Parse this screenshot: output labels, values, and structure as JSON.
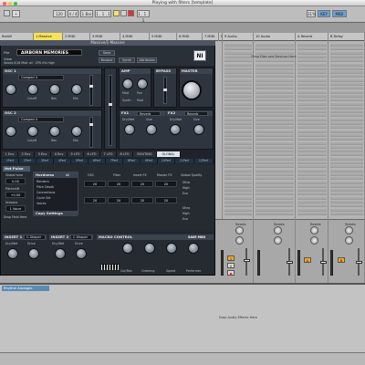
{
  "window": {
    "title": "Playing with filters [template]"
  },
  "transport": {
    "tempo": "120",
    "signature": "4 / 4",
    "bars": "1 Bar",
    "position": "1 . 1 . 1",
    "loop_start": "1 . 1 . 1",
    "cpu": "31%",
    "key_badge": "KEY",
    "midi_badge": "MIDI"
  },
  "tracks": [
    {
      "label": "Rodrill"
    },
    {
      "label": "1 Massive"
    },
    {
      "label": "2 MIDI"
    },
    {
      "label": "3 MIDI"
    },
    {
      "label": "4 MIDI"
    },
    {
      "label": "5 MIDI"
    },
    {
      "label": "6 MIDI"
    },
    {
      "label": "7 MIDI"
    },
    {
      "label": "8 MIDI"
    },
    {
      "label": "9 Audio"
    },
    {
      "label": "10 Audio"
    },
    {
      "label": "A Reverb"
    },
    {
      "label": "B Delay"
    }
  ],
  "session": {
    "drop_hint": "Drop Files and Devices Here"
  },
  "plugin": {
    "window_title": "Massive/1-Massive",
    "file_label": "File",
    "view_label": "View",
    "preset_name": "AIRBORN MEMORIES",
    "info_line": "Voices  0/16   Midi: all  ·  CPU  0%  High",
    "save_label": "Save",
    "browse_label": "Browse",
    "synth_label": "Synth",
    "attributes_label": "Attributes",
    "logo": "NI",
    "osc1_title": "OSC 1",
    "osc1_wave": "Comped 4",
    "osc2_title": "OSC 2",
    "osc2_wave": "Comped 4",
    "osc3_title": "OSC 3",
    "filter1_title": "FILTER 1",
    "filter1_type": "Lowpass 4",
    "filter2_title": "FILTER 2",
    "filter2_type": "Lowpass 4",
    "amp_title": "AMP",
    "bypass_title": "BYPASS",
    "master_title": "MASTER",
    "fx1_title": "FX1",
    "fx1_type": "Reverb",
    "fx2_title": "FX2",
    "fx2_type": "Reverb",
    "knob_labels": [
      "Cutoff",
      "Res",
      "Mix",
      "Cutoff",
      "Res",
      "Mix",
      "Dry/Wet",
      "Size",
      "Dry/Wet",
      "Size"
    ],
    "amp_labels": [
      "Mod",
      "Pan",
      "Synth",
      "Mod"
    ],
    "tabs": [
      "1 Env",
      "2 Env",
      "3 Env",
      "4 Env",
      "5 LFO",
      "6 LFO",
      "7 LFO",
      "8 LFO",
      "ROUTING",
      "GLOBAL"
    ],
    "tab_active": "GLOBAL",
    "mod_strip": [
      "1Perf",
      "2Perf",
      "3Perf",
      "4Perf",
      "5Perf",
      "6Perf",
      "7Perf",
      "8Perf",
      "9Perf",
      "10Perf",
      "11Perf",
      "12Perf"
    ],
    "global_header": "Hot Pulse",
    "global_tune_label": "Global tune",
    "global_tune_value": "0.00",
    "pitchshift_label": "Pitchshift",
    "pitchshift_value": "+0.00",
    "unison_label": "Unisono",
    "unison_value": "1 Voice",
    "hardness_label": "Hardness",
    "hardness_value": "All",
    "column_labels": [
      "OSC",
      "Filter",
      "Insert FX",
      "Master FX",
      "Global Quality"
    ],
    "values_row1": [
      "20",
      "20",
      "20",
      "20"
    ],
    "values_row2": [
      "20",
      "20",
      "20",
      "20"
    ],
    "quality_options": [
      "Ultra",
      "High",
      "Eco"
    ],
    "mod_rows": [
      "Random",
      "Pitch Depth",
      "Connections",
      "Cycle Set",
      "Voices"
    ],
    "drag_hint": "Drop Field Here",
    "copy_settings": "Copy Settings",
    "insert1_title": "INSERT 1",
    "insert1_type": "C-Shaper",
    "insert2_title": "INSERT 2",
    "insert2_type": "C-Shaper",
    "macro_title": "MACRO CONTROL",
    "save_midi": "SAVE MIDI",
    "macro_labels": [
      "Cut/Res",
      "Ordering",
      "Speed",
      "Performer"
    ],
    "insert_knob_labels": [
      "Dry/Wet",
      "Drive",
      "Dry/Wet",
      "Drive"
    ]
  },
  "mixer": {
    "sends_label": "Sends",
    "track_numbers": [
      "1",
      "2",
      "3"
    ],
    "solo_label": "S",
    "arm_label": "●",
    "return_labels": [
      "A",
      "B",
      "C"
    ]
  },
  "device": {
    "name": "Rhythm Arpeggio",
    "drop_fx": "Drop Audio Effects Here"
  },
  "colors": {
    "accent_yellow": "#f7e35a",
    "plugin_bg": "#1f2329",
    "record_red": "#e03030",
    "button_orange": "#f2a82a"
  }
}
